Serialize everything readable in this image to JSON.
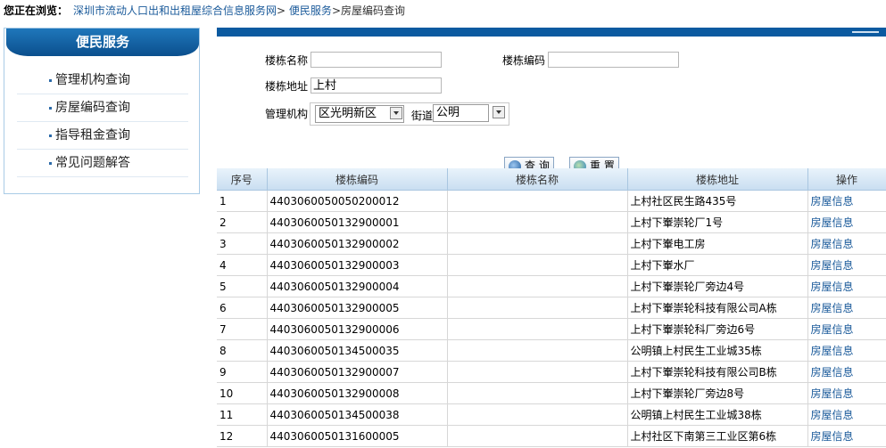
{
  "breadcrumb": {
    "label": "您正在浏览：",
    "site": "深圳市流动人口出和出租屋综合信息服务网",
    "sep1": ">",
    "section": "便民服务",
    "sep2": ">",
    "current": "房屋编码查询"
  },
  "sidebar": {
    "title": "便民服务",
    "items": [
      {
        "label": "管理机构查询"
      },
      {
        "label": "房屋编码查询"
      },
      {
        "label": "指导租金查询"
      },
      {
        "label": "常见问题解答"
      }
    ]
  },
  "form": {
    "building_name_label": "楼栋名称",
    "building_name_value": "",
    "building_code_label": "楼栋编码",
    "building_code_value": "",
    "building_address_label": "楼栋地址",
    "building_address_value": "上村",
    "org_label": "管理机构",
    "district_value": "区光明新区",
    "street_label": "街道",
    "street_value": "公明",
    "query_label": "查 询",
    "reset_label": "重 置"
  },
  "table": {
    "headers": [
      "序号",
      "楼栋编码",
      "楼栋名称",
      "楼栋地址",
      "操作"
    ],
    "rows": [
      {
        "no": "1",
        "code": "4403060050050200012",
        "name": "",
        "address": "上村社区民生路435号",
        "op": "房屋信息"
      },
      {
        "no": "2",
        "code": "4403060050132900001",
        "name": "",
        "address": "上村下輋崇轮厂1号",
        "op": "房屋信息"
      },
      {
        "no": "3",
        "code": "4403060050132900002",
        "name": "",
        "address": "上村下輋电工房",
        "op": "房屋信息"
      },
      {
        "no": "4",
        "code": "4403060050132900003",
        "name": "",
        "address": "上村下輋水厂",
        "op": "房屋信息"
      },
      {
        "no": "5",
        "code": "4403060050132900004",
        "name": "",
        "address": "上村下輋崇轮厂旁边4号",
        "op": "房屋信息"
      },
      {
        "no": "6",
        "code": "4403060050132900005",
        "name": "",
        "address": "上村下輋崇轮科技有限公司A栋",
        "op": "房屋信息"
      },
      {
        "no": "7",
        "code": "4403060050132900006",
        "name": "",
        "address": "上村下輋崇轮科厂旁边6号",
        "op": "房屋信息"
      },
      {
        "no": "8",
        "code": "4403060050134500035",
        "name": "",
        "address": "公明镇上村民生工业城35栋",
        "op": "房屋信息"
      },
      {
        "no": "9",
        "code": "4403060050132900007",
        "name": "",
        "address": "上村下輋崇轮科技有限公司B栋",
        "op": "房屋信息"
      },
      {
        "no": "10",
        "code": "4403060050132900008",
        "name": "",
        "address": "上村下輋崇轮厂旁边8号",
        "op": "房屋信息"
      },
      {
        "no": "11",
        "code": "4403060050134500038",
        "name": "",
        "address": "公明镇上村民生工业城38栋",
        "op": "房屋信息"
      },
      {
        "no": "12",
        "code": "4403060050131600005",
        "name": "",
        "address": "上村社区下南第三工业区第6栋",
        "op": "房屋信息"
      }
    ]
  },
  "colors": {
    "accent": "#0b5aa0",
    "link": "#1a5a9a"
  }
}
